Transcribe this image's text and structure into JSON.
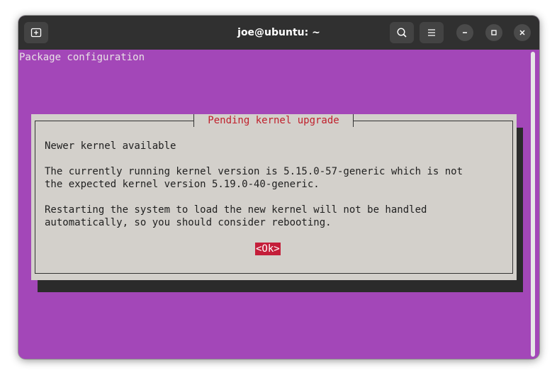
{
  "window": {
    "title": "joe@ubuntu: ~",
    "controls": [
      "new-tab-icon",
      "search-icon",
      "menu-icon",
      "minimize-icon",
      "maximize-icon",
      "close-icon"
    ]
  },
  "terminal": {
    "header": "Package configuration",
    "background": "#a347b8"
  },
  "dialog": {
    "title": "Pending kernel upgrade",
    "lines": [
      "Newer kernel available",
      "The currently running kernel version is 5.15.0-57-generic which is not",
      "the expected kernel version 5.19.0-40-generic.",
      "Restarting the system to load the new kernel will not be handled",
      "automatically, so you should consider rebooting."
    ],
    "ok_label": "<Ok>",
    "title_color": "#c0202c",
    "button_color": "#c41e3a"
  }
}
